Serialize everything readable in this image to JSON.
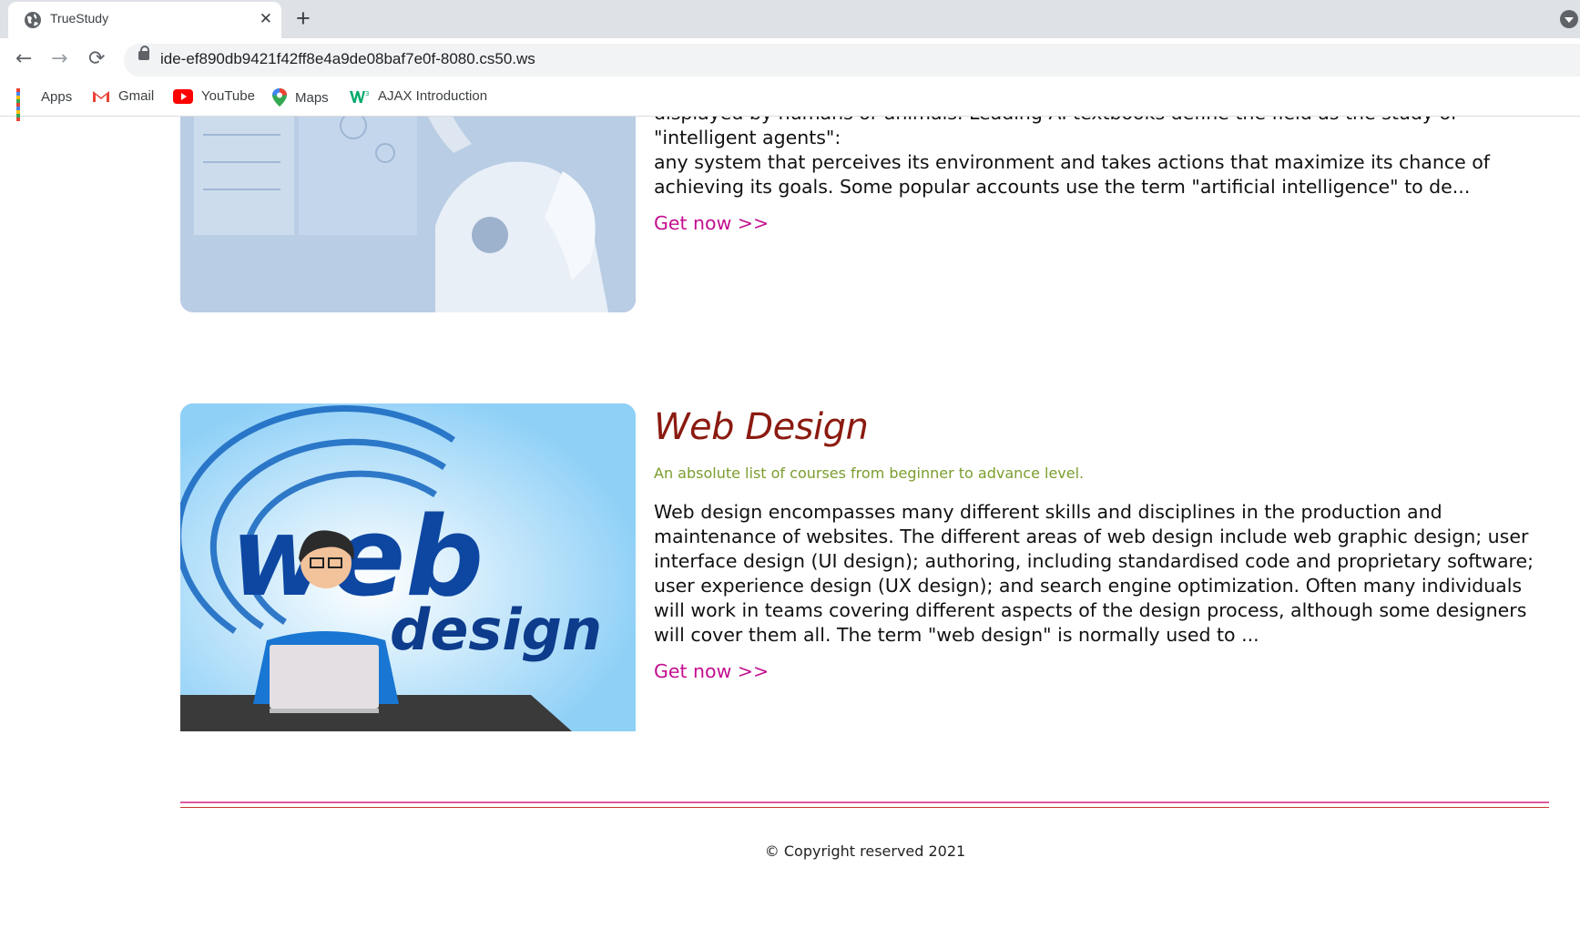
{
  "browser": {
    "tab_title": "TrueStudy",
    "tab_close": "✕",
    "new_tab": "+",
    "url": "ide-ef890db9421f42ff8e4a9de08baf7e0f-8080.cs50.ws",
    "nav": {
      "back": "←",
      "forward": "→",
      "reload": "⟳"
    },
    "bookmarks": [
      {
        "label": "Apps",
        "icon": "apps-grid-icon"
      },
      {
        "label": "Gmail",
        "icon": "gmail-icon"
      },
      {
        "label": "YouTube",
        "icon": "youtube-icon"
      },
      {
        "label": "Maps",
        "icon": "maps-pin-icon"
      },
      {
        "label": "AJAX Introduction",
        "icon": "w3schools-icon"
      }
    ]
  },
  "courses": [
    {
      "image_alt": "robot-image",
      "partial_top_text": "displayed by humans or animals. Leading AI textbooks define the field as the study of \"intelligent agents\":",
      "description": "any system that perceives its environment and takes actions that maximize its chance of achieving its goals. Some popular accounts use the term \"artificial intelligence\" to de...",
      "cta": "Get now >>"
    },
    {
      "image_alt": "web-design-image",
      "image_text_top": "web",
      "image_text_bottom": "design",
      "title": "Web Design",
      "subtitle": "An absolute list of courses from beginner to advance level.",
      "description": "Web design encompasses many different skills and disciplines in the production and maintenance of websites. The different areas of web design include web graphic design; user interface design (UI design); authoring, including standardised code and proprietary software; user experience design (UX design); and search engine optimization. Often many individuals will work in teams covering different aspects of the design process, although some designers will cover them all. The term \"web design\" is normally used to ...",
      "cta": "Get now >>"
    }
  ],
  "footer": {
    "text": "© Copyright reserved 2021"
  },
  "colors": {
    "link": "#c2108f",
    "title": "#8b1a10",
    "subtitle": "#7b9d2e",
    "divider_top": "#e05a9a",
    "divider_bottom": "#c0392b"
  }
}
